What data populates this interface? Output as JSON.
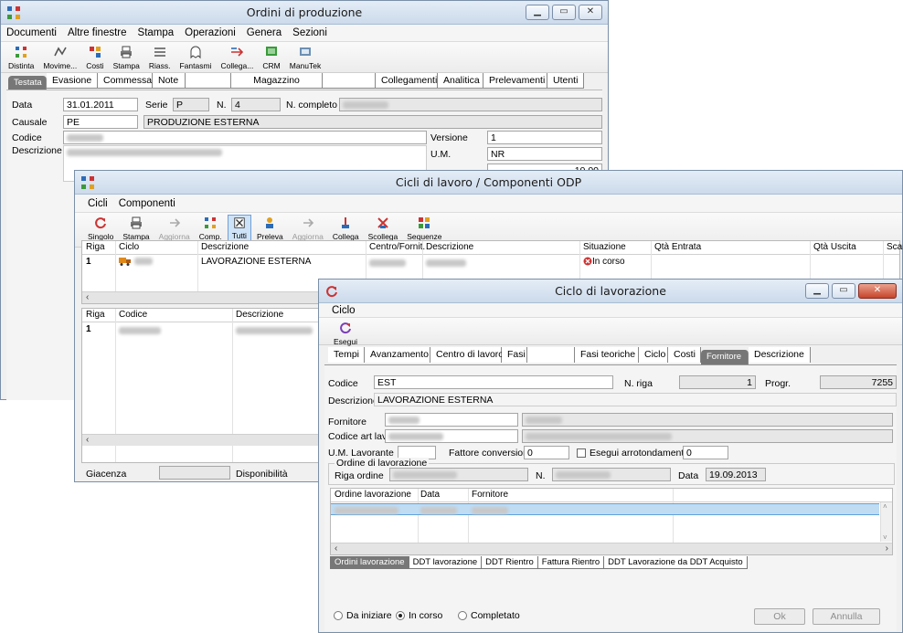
{
  "win1": {
    "title": "Ordini di produzione",
    "menu": [
      "Documenti",
      "Altre finestre",
      "Stampa",
      "Operazioni",
      "Genera",
      "Sezioni"
    ],
    "toolbar": [
      "Distinta",
      "Movime...",
      "Costi",
      "Stampa",
      "Riass.",
      "Fantasmi",
      "Collega...",
      "CRM",
      "ManuTek"
    ],
    "tabs": [
      "Testata",
      "Evasione",
      "Commessa",
      "Note",
      "",
      "Magazzino",
      "",
      "Collegamenti",
      "Analitica",
      "Prelevamenti",
      "Utenti"
    ],
    "data_label": "Data",
    "data_value": "31.01.2011",
    "serie_label": "Serie",
    "serie_value": "P",
    "n_label": "N.",
    "n_value": "4",
    "ncompleto_label": "N. completo",
    "causale_label": "Causale",
    "causale_value": "PE",
    "causale_desc": "PRODUZIONE ESTERNA",
    "codice_label": "Codice",
    "descrizione_label": "Descrizione",
    "versione_label": "Versione",
    "versione_value": "1",
    "um_label": "U.M.",
    "um_value": "NR",
    "qty_value": "10,00"
  },
  "win2": {
    "title": "Cicli di lavoro / Componenti ODP",
    "menu": [
      "Cicli",
      "Componenti"
    ],
    "toolbar": [
      "Singolo",
      "Stampa",
      "Aggiorna",
      "Comp.",
      "Tutti",
      "Preleva",
      "Aggiorna",
      "Collega",
      "Scollega",
      "Sequenze"
    ],
    "grid1_headers": [
      "Riga",
      "Ciclo",
      "Descrizione",
      "Centro/Fornit.",
      "Descrizione",
      "Situazione",
      "Qtà Entrata",
      "Qtà Uscita",
      "Scar"
    ],
    "grid1_row": {
      "riga": "1",
      "descrizione": "LAVORAZIONE ESTERNA",
      "situazione": "In corso"
    },
    "grid2_headers": [
      "Riga",
      "Codice",
      "Descrizione"
    ],
    "grid2_row": {
      "riga": "1"
    },
    "giacenza_label": "Giacenza",
    "disponibilita_label": "Disponibilità"
  },
  "win3": {
    "title": "Ciclo di lavorazione",
    "menu": [
      "Ciclo"
    ],
    "toolbar": [
      "Esegui"
    ],
    "tabs": [
      "Tempi",
      "Avanzamento",
      "Centro di lavoro",
      "Fasi",
      "",
      "Fasi teoriche",
      "Ciclo",
      "Costi",
      "Fornitore",
      "Descrizione"
    ],
    "codice_label": "Codice",
    "codice_value": "EST",
    "nriga_label": "N. riga",
    "nriga_value": "1",
    "progr_label": "Progr.",
    "progr_value": "7255",
    "descrizione_label": "Descrizione",
    "descrizione_value": "LAVORAZIONE ESTERNA",
    "fornitore_label": "Fornitore",
    "codart_label": "Codice art lav.",
    "umlav_label": "U.M. Lavorante",
    "fattore_label": "Fattore conversione",
    "fattore_value": "0",
    "esegui_arr_label": "Esegui arrotondamento a",
    "arr_value": "0",
    "ordine_group": "Ordine di lavorazione",
    "riga_ordine_label": "Riga ordine",
    "n_label": "N.",
    "data_label": "Data",
    "data_value": "19.09.2013",
    "grid_headers": [
      "Ordine lavorazione",
      "Data",
      "Fornitore"
    ],
    "bottom_tabs": [
      "Ordini lavorazione",
      "DDT lavorazione",
      "DDT Rientro",
      "Fattura Rientro",
      "DDT Lavorazione da DDT Acquisto"
    ],
    "radios": [
      "Da iniziare",
      "In corso",
      "Completato"
    ],
    "ok_label": "Ok",
    "annulla_label": "Annulla"
  },
  "colors": {
    "accent": "#cfe3f8",
    "tab_selected": "#777777",
    "close_red": "#c7442a"
  }
}
